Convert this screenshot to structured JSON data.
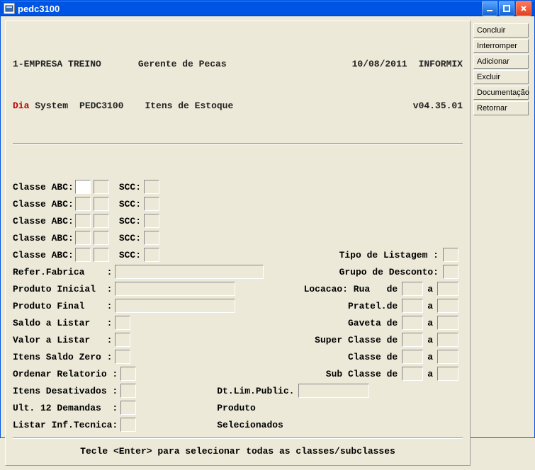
{
  "window": {
    "title": "pedc3100"
  },
  "header": {
    "company": "1-EMPRESA TREINO",
    "role": "Gerente de Pecas",
    "date": "10/08/2011",
    "db": "INFORMIX",
    "dia": "Dia",
    "system": "System",
    "program": "PEDC3100",
    "subtitle": "Itens de Estoque",
    "version": "v04.35.01"
  },
  "sidebar": {
    "buttons": [
      "Concluir",
      "Interromper",
      "Adicionar",
      "Excluir",
      "Documentação",
      "Retornar"
    ]
  },
  "labels": {
    "classe_abc": "Classe ABC:",
    "scc": "SCC:",
    "tipo_listagem": "Tipo de Listagem :",
    "grupo_desconto": "Grupo de Desconto:",
    "refer_fabrica": "Refer.Fabrica    :",
    "produto_inicial": "Produto Inicial  :",
    "produto_final": "Produto Final    :",
    "saldo_listar": "Saldo a Listar   :",
    "valor_listar": "Valor a Listar   :",
    "itens_saldo_zero": "Itens Saldo Zero :",
    "ordenar_rel": "Ordenar Relatorio :",
    "itens_desativ": "Itens Desativados :",
    "ult_12": "Ult. 12 Demandas  :",
    "listar_inf": "Listar Inf.Tecnica:",
    "locacao": "Locacao: Rua   de",
    "pratel": "Pratel.de",
    "gaveta": "Gaveta de",
    "super": "Super Classe de",
    "classe": "Classe de",
    "sub": "Sub Classe de",
    "a": "a",
    "dtlim": "Dt.Lim.Public.",
    "produto": "Produto",
    "selecionados": "Selecionados"
  },
  "status": "Tecle <Enter> para selecionar todas as classes/subclasses"
}
